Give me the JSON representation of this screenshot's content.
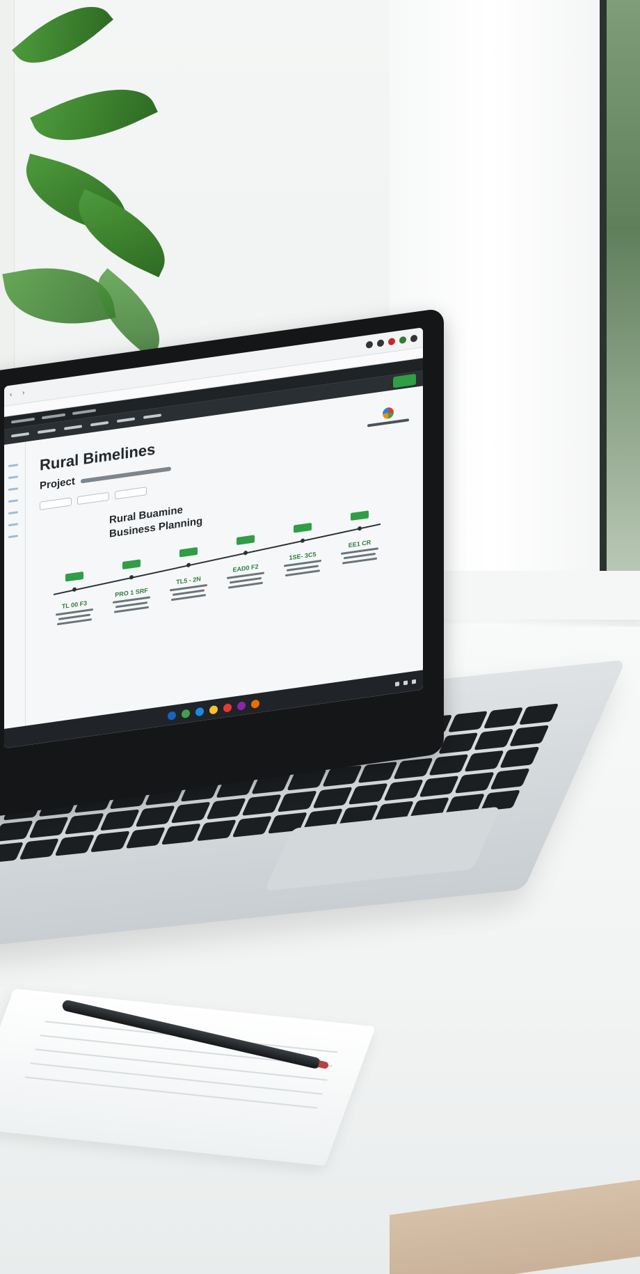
{
  "screen": {
    "app": {
      "title": "Rural Bimelines",
      "project_label": "Project",
      "section_title_line1": "Rural Buamine",
      "section_title_line2": "Business Planning"
    },
    "timeline": {
      "milestones": [
        {
          "label": "TL 00 F3"
        },
        {
          "label": "PRO 1 SRF"
        },
        {
          "label": "TL5 - 2N"
        },
        {
          "label": "EAD0 F2"
        },
        {
          "label": "1SE- 3C5"
        },
        {
          "label": "EE1 CR"
        }
      ]
    }
  },
  "colors": {
    "accent_green": "#2f9e44",
    "timeline_line": "#2b3136"
  },
  "icons": [
    "back-arrow-icon",
    "forward-arrow-icon",
    "extension-icon",
    "menu-icon",
    "logo-icon",
    "dock-app-icon",
    "wifi-icon",
    "battery-icon"
  ]
}
